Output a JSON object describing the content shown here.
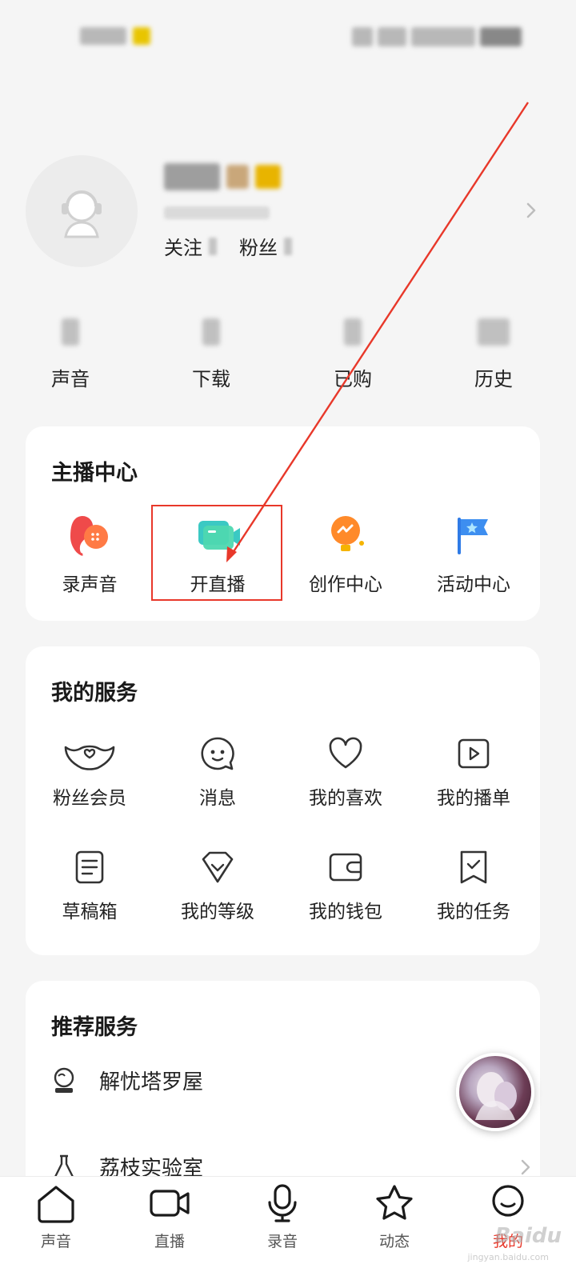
{
  "profile": {
    "follow_label": "关注",
    "fans_label": "粉丝"
  },
  "stats": [
    {
      "label": "声音"
    },
    {
      "label": "下载"
    },
    {
      "label": "已购"
    },
    {
      "label": "历史"
    }
  ],
  "anchor_center": {
    "title": "主播中心",
    "items": [
      {
        "label": "录声音",
        "icon": "record-voice-icon"
      },
      {
        "label": "开直播",
        "icon": "start-live-icon"
      },
      {
        "label": "创作中心",
        "icon": "creation-center-icon"
      },
      {
        "label": "活动中心",
        "icon": "activity-flag-icon"
      }
    ]
  },
  "my_services": {
    "title": "我的服务",
    "items": [
      {
        "label": "粉丝会员",
        "icon": "fan-membership-icon"
      },
      {
        "label": "消息",
        "icon": "message-icon"
      },
      {
        "label": "我的喜欢",
        "icon": "heart-icon"
      },
      {
        "label": "我的播单",
        "icon": "playlist-icon"
      },
      {
        "label": "草稿箱",
        "icon": "drafts-icon"
      },
      {
        "label": "我的等级",
        "icon": "level-icon"
      },
      {
        "label": "我的钱包",
        "icon": "wallet-icon"
      },
      {
        "label": "我的任务",
        "icon": "task-icon"
      }
    ]
  },
  "recommended": {
    "title": "推荐服务",
    "items": [
      {
        "label": "解忧塔罗屋",
        "icon": "tarot-crystal-icon"
      },
      {
        "label": "荔枝实验室",
        "icon": "lab-flask-icon"
      }
    ]
  },
  "bottom_nav": [
    {
      "label": "声音",
      "icon": "home-icon"
    },
    {
      "label": "直播",
      "icon": "video-camera-icon"
    },
    {
      "label": "录音",
      "icon": "microphone-icon"
    },
    {
      "label": "动态",
      "icon": "star-icon"
    },
    {
      "label": "我的",
      "icon": "profile-icon",
      "active": true
    }
  ],
  "watermark": {
    "text": "Baidu",
    "sub": "jingyan.baidu.com"
  },
  "colors": {
    "accent": "#e8382a",
    "background": "#f5f5f5",
    "card": "#ffffff"
  }
}
